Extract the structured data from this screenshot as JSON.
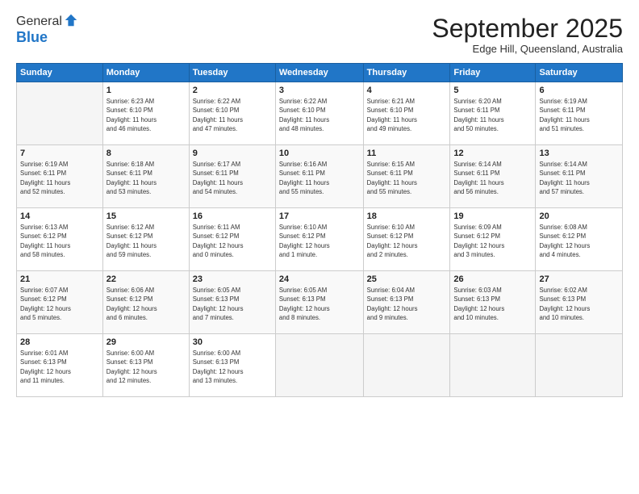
{
  "logo": {
    "general": "General",
    "blue": "Blue"
  },
  "header": {
    "month": "September 2025",
    "location": "Edge Hill, Queensland, Australia"
  },
  "days_of_week": [
    "Sunday",
    "Monday",
    "Tuesday",
    "Wednesday",
    "Thursday",
    "Friday",
    "Saturday"
  ],
  "weeks": [
    [
      {
        "day": "",
        "info": ""
      },
      {
        "day": "1",
        "info": "Sunrise: 6:23 AM\nSunset: 6:10 PM\nDaylight: 11 hours\nand 46 minutes."
      },
      {
        "day": "2",
        "info": "Sunrise: 6:22 AM\nSunset: 6:10 PM\nDaylight: 11 hours\nand 47 minutes."
      },
      {
        "day": "3",
        "info": "Sunrise: 6:22 AM\nSunset: 6:10 PM\nDaylight: 11 hours\nand 48 minutes."
      },
      {
        "day": "4",
        "info": "Sunrise: 6:21 AM\nSunset: 6:10 PM\nDaylight: 11 hours\nand 49 minutes."
      },
      {
        "day": "5",
        "info": "Sunrise: 6:20 AM\nSunset: 6:11 PM\nDaylight: 11 hours\nand 50 minutes."
      },
      {
        "day": "6",
        "info": "Sunrise: 6:19 AM\nSunset: 6:11 PM\nDaylight: 11 hours\nand 51 minutes."
      }
    ],
    [
      {
        "day": "7",
        "info": "Sunrise: 6:19 AM\nSunset: 6:11 PM\nDaylight: 11 hours\nand 52 minutes."
      },
      {
        "day": "8",
        "info": "Sunrise: 6:18 AM\nSunset: 6:11 PM\nDaylight: 11 hours\nand 53 minutes."
      },
      {
        "day": "9",
        "info": "Sunrise: 6:17 AM\nSunset: 6:11 PM\nDaylight: 11 hours\nand 54 minutes."
      },
      {
        "day": "10",
        "info": "Sunrise: 6:16 AM\nSunset: 6:11 PM\nDaylight: 11 hours\nand 55 minutes."
      },
      {
        "day": "11",
        "info": "Sunrise: 6:15 AM\nSunset: 6:11 PM\nDaylight: 11 hours\nand 55 minutes."
      },
      {
        "day": "12",
        "info": "Sunrise: 6:14 AM\nSunset: 6:11 PM\nDaylight: 11 hours\nand 56 minutes."
      },
      {
        "day": "13",
        "info": "Sunrise: 6:14 AM\nSunset: 6:11 PM\nDaylight: 11 hours\nand 57 minutes."
      }
    ],
    [
      {
        "day": "14",
        "info": "Sunrise: 6:13 AM\nSunset: 6:12 PM\nDaylight: 11 hours\nand 58 minutes."
      },
      {
        "day": "15",
        "info": "Sunrise: 6:12 AM\nSunset: 6:12 PM\nDaylight: 11 hours\nand 59 minutes."
      },
      {
        "day": "16",
        "info": "Sunrise: 6:11 AM\nSunset: 6:12 PM\nDaylight: 12 hours\nand 0 minutes."
      },
      {
        "day": "17",
        "info": "Sunrise: 6:10 AM\nSunset: 6:12 PM\nDaylight: 12 hours\nand 1 minute."
      },
      {
        "day": "18",
        "info": "Sunrise: 6:10 AM\nSunset: 6:12 PM\nDaylight: 12 hours\nand 2 minutes."
      },
      {
        "day": "19",
        "info": "Sunrise: 6:09 AM\nSunset: 6:12 PM\nDaylight: 12 hours\nand 3 minutes."
      },
      {
        "day": "20",
        "info": "Sunrise: 6:08 AM\nSunset: 6:12 PM\nDaylight: 12 hours\nand 4 minutes."
      }
    ],
    [
      {
        "day": "21",
        "info": "Sunrise: 6:07 AM\nSunset: 6:12 PM\nDaylight: 12 hours\nand 5 minutes."
      },
      {
        "day": "22",
        "info": "Sunrise: 6:06 AM\nSunset: 6:12 PM\nDaylight: 12 hours\nand 6 minutes."
      },
      {
        "day": "23",
        "info": "Sunrise: 6:05 AM\nSunset: 6:13 PM\nDaylight: 12 hours\nand 7 minutes."
      },
      {
        "day": "24",
        "info": "Sunrise: 6:05 AM\nSunset: 6:13 PM\nDaylight: 12 hours\nand 8 minutes."
      },
      {
        "day": "25",
        "info": "Sunrise: 6:04 AM\nSunset: 6:13 PM\nDaylight: 12 hours\nand 9 minutes."
      },
      {
        "day": "26",
        "info": "Sunrise: 6:03 AM\nSunset: 6:13 PM\nDaylight: 12 hours\nand 10 minutes."
      },
      {
        "day": "27",
        "info": "Sunrise: 6:02 AM\nSunset: 6:13 PM\nDaylight: 12 hours\nand 10 minutes."
      }
    ],
    [
      {
        "day": "28",
        "info": "Sunrise: 6:01 AM\nSunset: 6:13 PM\nDaylight: 12 hours\nand 11 minutes."
      },
      {
        "day": "29",
        "info": "Sunrise: 6:00 AM\nSunset: 6:13 PM\nDaylight: 12 hours\nand 12 minutes."
      },
      {
        "day": "30",
        "info": "Sunrise: 6:00 AM\nSunset: 6:13 PM\nDaylight: 12 hours\nand 13 minutes."
      },
      {
        "day": "",
        "info": ""
      },
      {
        "day": "",
        "info": ""
      },
      {
        "day": "",
        "info": ""
      },
      {
        "day": "",
        "info": ""
      }
    ]
  ]
}
